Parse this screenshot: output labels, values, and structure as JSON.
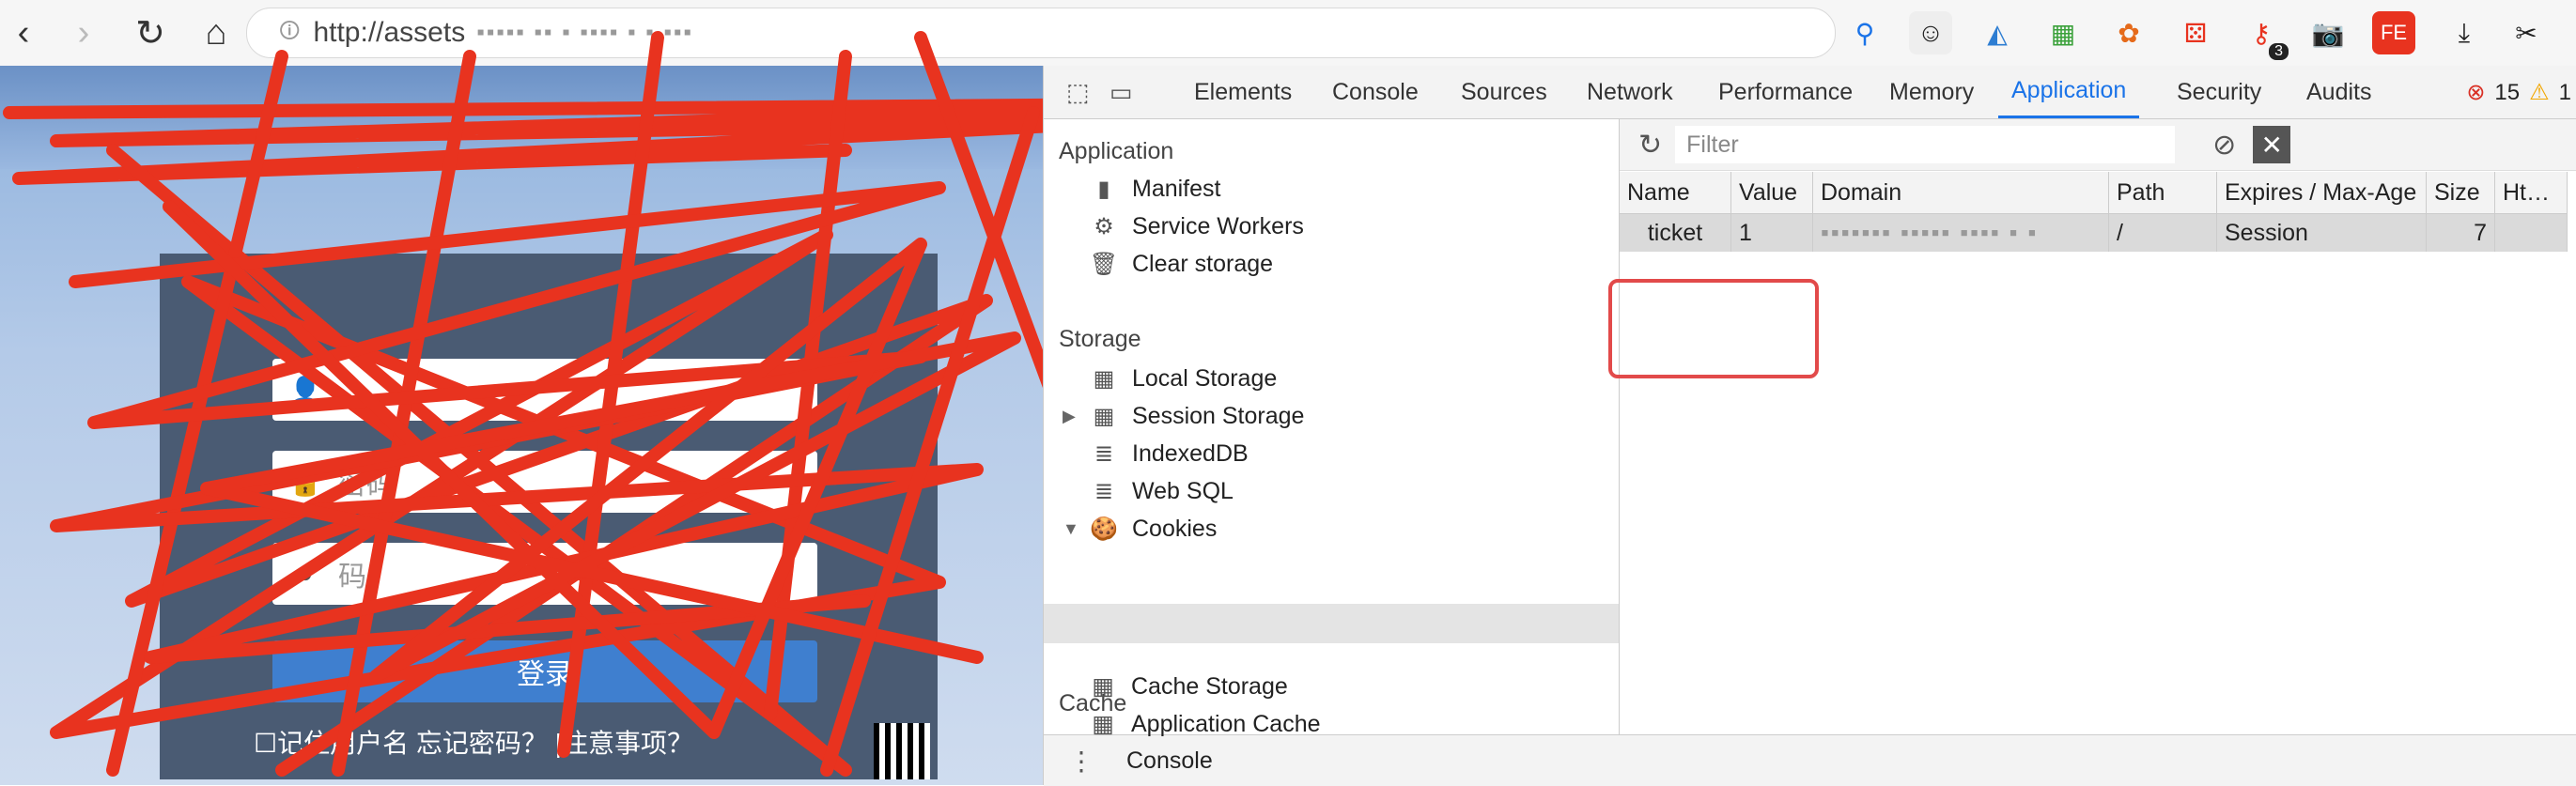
{
  "browser": {
    "url": "http://assets",
    "ext_badge": "3"
  },
  "page": {
    "password_placeholder": "密码",
    "captcha_placeholder": "码",
    "login_label": "登录",
    "remember_text": "记住用户名  忘记密码？  |注意事项？"
  },
  "devtools": {
    "tabs": [
      "Elements",
      "Console",
      "Sources",
      "Network",
      "Performance",
      "Memory",
      "Application",
      "Security",
      "Audits"
    ],
    "active_tab": "Application",
    "errors": "15",
    "warnings": "1",
    "sidebar": {
      "application_header": "Application",
      "application_items": [
        "Manifest",
        "Service Workers",
        "Clear storage"
      ],
      "storage_header": "Storage",
      "storage_items": [
        "Local Storage",
        "Session Storage",
        "IndexedDB",
        "Web SQL",
        "Cookies"
      ],
      "cache_header": "Cache",
      "cache_items": [
        "Cache Storage",
        "Application Cache"
      ]
    },
    "filter_placeholder": "Filter",
    "table": {
      "headers": [
        "Name",
        "Value",
        "Domain",
        "Path",
        "Expires / Max-Age",
        "Size",
        "Ht…"
      ],
      "rows": [
        {
          "name": "ticket",
          "value": "1",
          "domain": "",
          "path": "/",
          "expires": "Session",
          "size": "7",
          "http": ""
        }
      ]
    },
    "drawer_label": "Console"
  },
  "colors": {
    "accent": "#1a73e8",
    "scribble": "#e8331f",
    "highlight": "#e24a4a"
  }
}
